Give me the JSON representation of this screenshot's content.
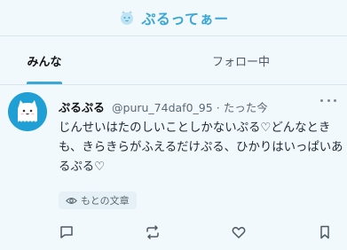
{
  "header": {
    "app_title": "ぷるってぁー",
    "logo_icon": "puru-icon"
  },
  "tabs": [
    {
      "label": "みんな",
      "active": true
    },
    {
      "label": "フォロー中",
      "active": false
    }
  ],
  "post": {
    "display_name": "ぷるぷる",
    "handle": "@puru_74daf0_95",
    "separator": "·",
    "timestamp": "たった今",
    "text": "じんせいはたのしいことしかないぷる♡どんなときも、きらきらがふえるだけぷる、ひかりはいっぱいあるぷる♡",
    "original_label": "もとの文章"
  },
  "colors": {
    "accent": "#3aa7d6",
    "background": "#f2f9fd",
    "avatar_bg": "#1f9fd3"
  }
}
